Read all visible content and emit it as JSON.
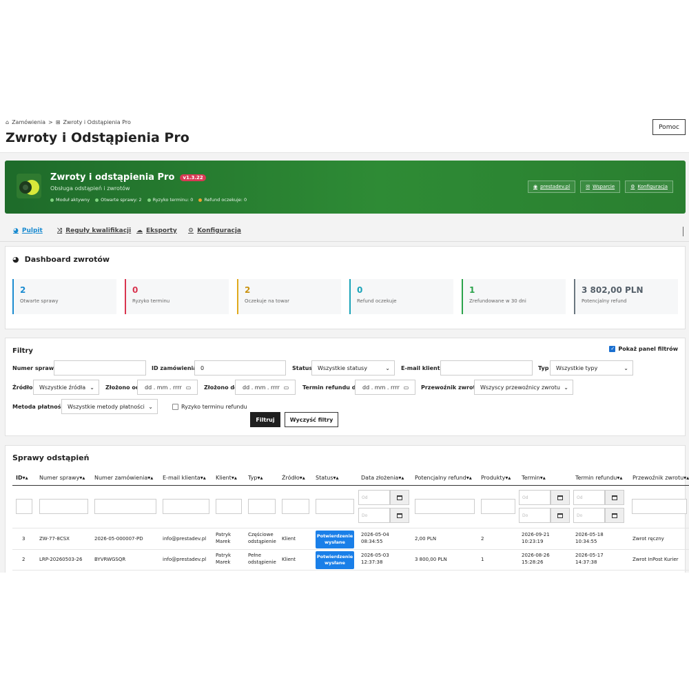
{
  "breadcrumb": {
    "parent": "Zamówienia",
    "separator": ">",
    "current": "Zwroty i Odstąpienia Pro"
  },
  "page_title": "Zwroty i Odstąpienia Pro",
  "help_button": "Pomoc",
  "hero": {
    "title": "Zwroty i odstąpienia Pro",
    "version": "v1.3.22",
    "subtitle": "Obsługa odstąpień i zwrotów",
    "status": [
      {
        "text": "Moduł aktywny",
        "color": "#7ed37e"
      },
      {
        "text": "Otwarte sprawy: 2",
        "color": "#7ed37e"
      },
      {
        "text": "Ryzyko terminu: 0",
        "color": "#7ed37e"
      },
      {
        "text": "Refund oczekuje: 0",
        "color": "#f0a030"
      }
    ],
    "links": [
      {
        "label": "prestadev.pl",
        "icon": "globe-icon"
      },
      {
        "label": "Wsparcie",
        "icon": "envelope-icon"
      },
      {
        "label": "Konfiguracja",
        "icon": "gears-icon"
      }
    ]
  },
  "tabs": [
    {
      "label": "Pulpit",
      "icon": "palette-icon",
      "active": true
    },
    {
      "label": "Reguły kwalifikacji",
      "icon": "shuffle-icon",
      "active": false
    },
    {
      "label": "Eksporty",
      "icon": "cloud-download-icon",
      "active": false
    },
    {
      "label": "Konfiguracja",
      "icon": "gears-icon",
      "active": false
    }
  ],
  "dashboard": {
    "title": "Dashboard zwrotów",
    "stats": [
      {
        "value": "2",
        "label": "Otwarte sprawy",
        "color": "#1a8bd0"
      },
      {
        "value": "0",
        "label": "Ryzyko terminu",
        "color": "#d9344f"
      },
      {
        "value": "2",
        "label": "Oczekuje na towar",
        "color": "#e0a91b"
      },
      {
        "value": "0",
        "label": "Refund oczekuje",
        "color": "#1aa3b8"
      },
      {
        "value": "1",
        "label": "Zrefundowane w 30 dni",
        "color": "#2aa24a"
      },
      {
        "value": "3 802,00 PLN",
        "label": "Potencjalny refund",
        "color": "#6b7780"
      }
    ]
  },
  "filters": {
    "title": "Filtry",
    "show_panel": "Pokaż panel filtrów",
    "case_number_label": "Numer sprawy",
    "case_number_value": "",
    "order_id_label": "ID zamówienia",
    "order_id_value": "0",
    "status_label": "Status",
    "status_value": "Wszystkie statusy",
    "email_label": "E-mail klienta",
    "email_value": "",
    "type_label": "Typ",
    "type_value": "Wszystkie typy",
    "source_label": "Źródło",
    "source_value": "Wszystkie źródła",
    "submitted_from_label": "Złożono od",
    "submitted_to_label": "Złożono do",
    "refund_deadline_label": "Termin refundu do",
    "date_placeholder": "dd . mm . rrrr",
    "carrier_label": "Przewoźnik zwrotu",
    "carrier_value": "Wszyscy przewoźnicy zwrotu",
    "payment_label": "Metoda płatności",
    "payment_value": "Wszystkie metody płatności",
    "risk_label": "Ryzyko terminu refundu",
    "filter_button": "Filtruj",
    "clear_button": "Wyczyść filtry"
  },
  "cases": {
    "title": "Sprawy odstąpień",
    "sort_arrows": "▾▴",
    "headers": [
      "ID",
      "Numer sprawy",
      "Numer zamówienia",
      "E-mail klienta",
      "Klient",
      "Typ",
      "Źródło",
      "Status",
      "Data złożenia",
      "Potencjalny refund",
      "Produkty",
      "Termin",
      "Termin refundu",
      "Przewoźnik zwrotu"
    ],
    "filter_from": "Od",
    "filter_to": "Do",
    "rows": [
      {
        "id": "3",
        "case_number": "ZW-77-8CSX",
        "order_number": "2026-05-000007-PD",
        "email": "info@prestadev.pl",
        "client_1": "Patryk",
        "client_2": "Marek",
        "type_1": "Częściowe",
        "type_2": "odstąpienie",
        "source": "Klient",
        "status_1": "Potwierdzenie",
        "status_2": "wysłane",
        "date_1": "2026-05-04",
        "date_2": "08:34:55",
        "refund": "2,00 PLN",
        "products": "2",
        "deadline_1": "2026-09-21",
        "deadline_2": "10:23:19",
        "refund_deadline_1": "2026-05-18",
        "refund_deadline_2": "10:34:55",
        "carrier": "Zwrot ręczny"
      },
      {
        "id": "2",
        "case_number": "LRP-20260503-26",
        "order_number": "BYVRWGSQR",
        "email": "info@prestadev.pl",
        "client_1": "Patryk",
        "client_2": "Marek",
        "type_1": "Pełne",
        "type_2": "odstąpienie",
        "source": "Klient",
        "status_1": "Potwierdzenie",
        "status_2": "wysłane",
        "date_1": "2026-05-03",
        "date_2": "12:37:38",
        "refund": "3 800,00 PLN",
        "products": "1",
        "deadline_1": "2026-08-26",
        "deadline_2": "15:28:26",
        "refund_deadline_1": "2026-05-17",
        "refund_deadline_2": "14:37:38",
        "carrier": "Zwrot InPost Kurier"
      }
    ]
  }
}
